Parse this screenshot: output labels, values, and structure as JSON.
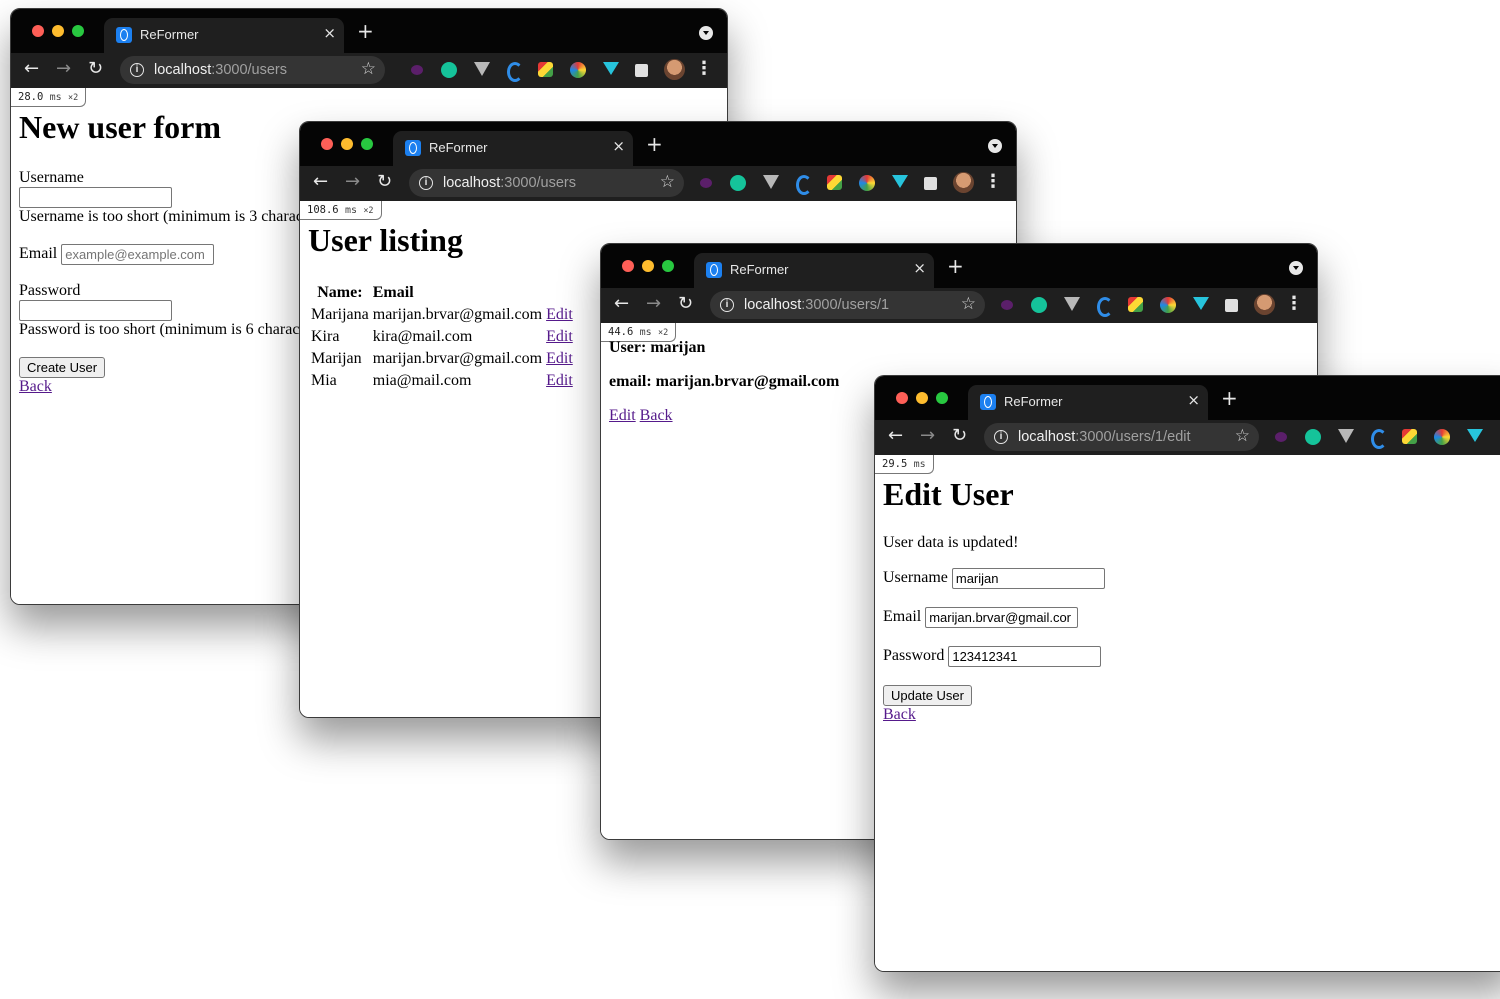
{
  "browser": {
    "tab_title": "ReFormer",
    "url_host": "localhost",
    "new_tab_symbol": "+",
    "close_symbol": "×"
  },
  "windows": {
    "new_user": {
      "url_path": ":3000/users",
      "timing": {
        "value": "28.0",
        "unit": "ms",
        "mult": "×2"
      },
      "title": "New user form",
      "username_label": "Username",
      "username_value": "",
      "username_error": "Username is too short (minimum is 3 charac",
      "email_label": "Email",
      "email_placeholder": "example@example.com",
      "password_label": "Password",
      "password_value": "",
      "password_error": "Password is too short (minimum is 6 charac",
      "submit_label": "Create User",
      "back_label": "Back"
    },
    "listing": {
      "url_path": ":3000/users",
      "timing": {
        "value": "108.6",
        "unit": "ms",
        "mult": "×2"
      },
      "title": "User listing",
      "columns": [
        "Name:",
        "Email"
      ],
      "rows": [
        {
          "name": "Marijana",
          "email": "marijan.brvar@gmail.com",
          "action": "Edit"
        },
        {
          "name": "Kira",
          "email": "kira@mail.com",
          "action": "Edit"
        },
        {
          "name": "Marijan",
          "email": "marijan.brvar@gmail.com",
          "action": "Edit"
        },
        {
          "name": "Mia",
          "email": "mia@mail.com",
          "action": "Edit"
        }
      ]
    },
    "show_user": {
      "url_path": ":3000/users/1",
      "timing": {
        "value": "44.6",
        "unit": "ms",
        "mult": "×2"
      },
      "user_line": "User: marijan",
      "email_line": "email: marijan.brvar@gmail.com",
      "edit_label": "Edit",
      "back_label": "Back"
    },
    "edit_user": {
      "url_path": ":3000/users/1/edit",
      "timing": {
        "value": "29.5",
        "unit": "ms"
      },
      "title": "Edit User",
      "notice": "User data is updated!",
      "username_label": "Username",
      "username_value": "marijan",
      "email_label": "Email",
      "email_value": "marijan.brvar@gmail.cor",
      "password_label": "Password",
      "password_value": "123412341",
      "submit_label": "Update User",
      "back_label": "Back"
    }
  }
}
